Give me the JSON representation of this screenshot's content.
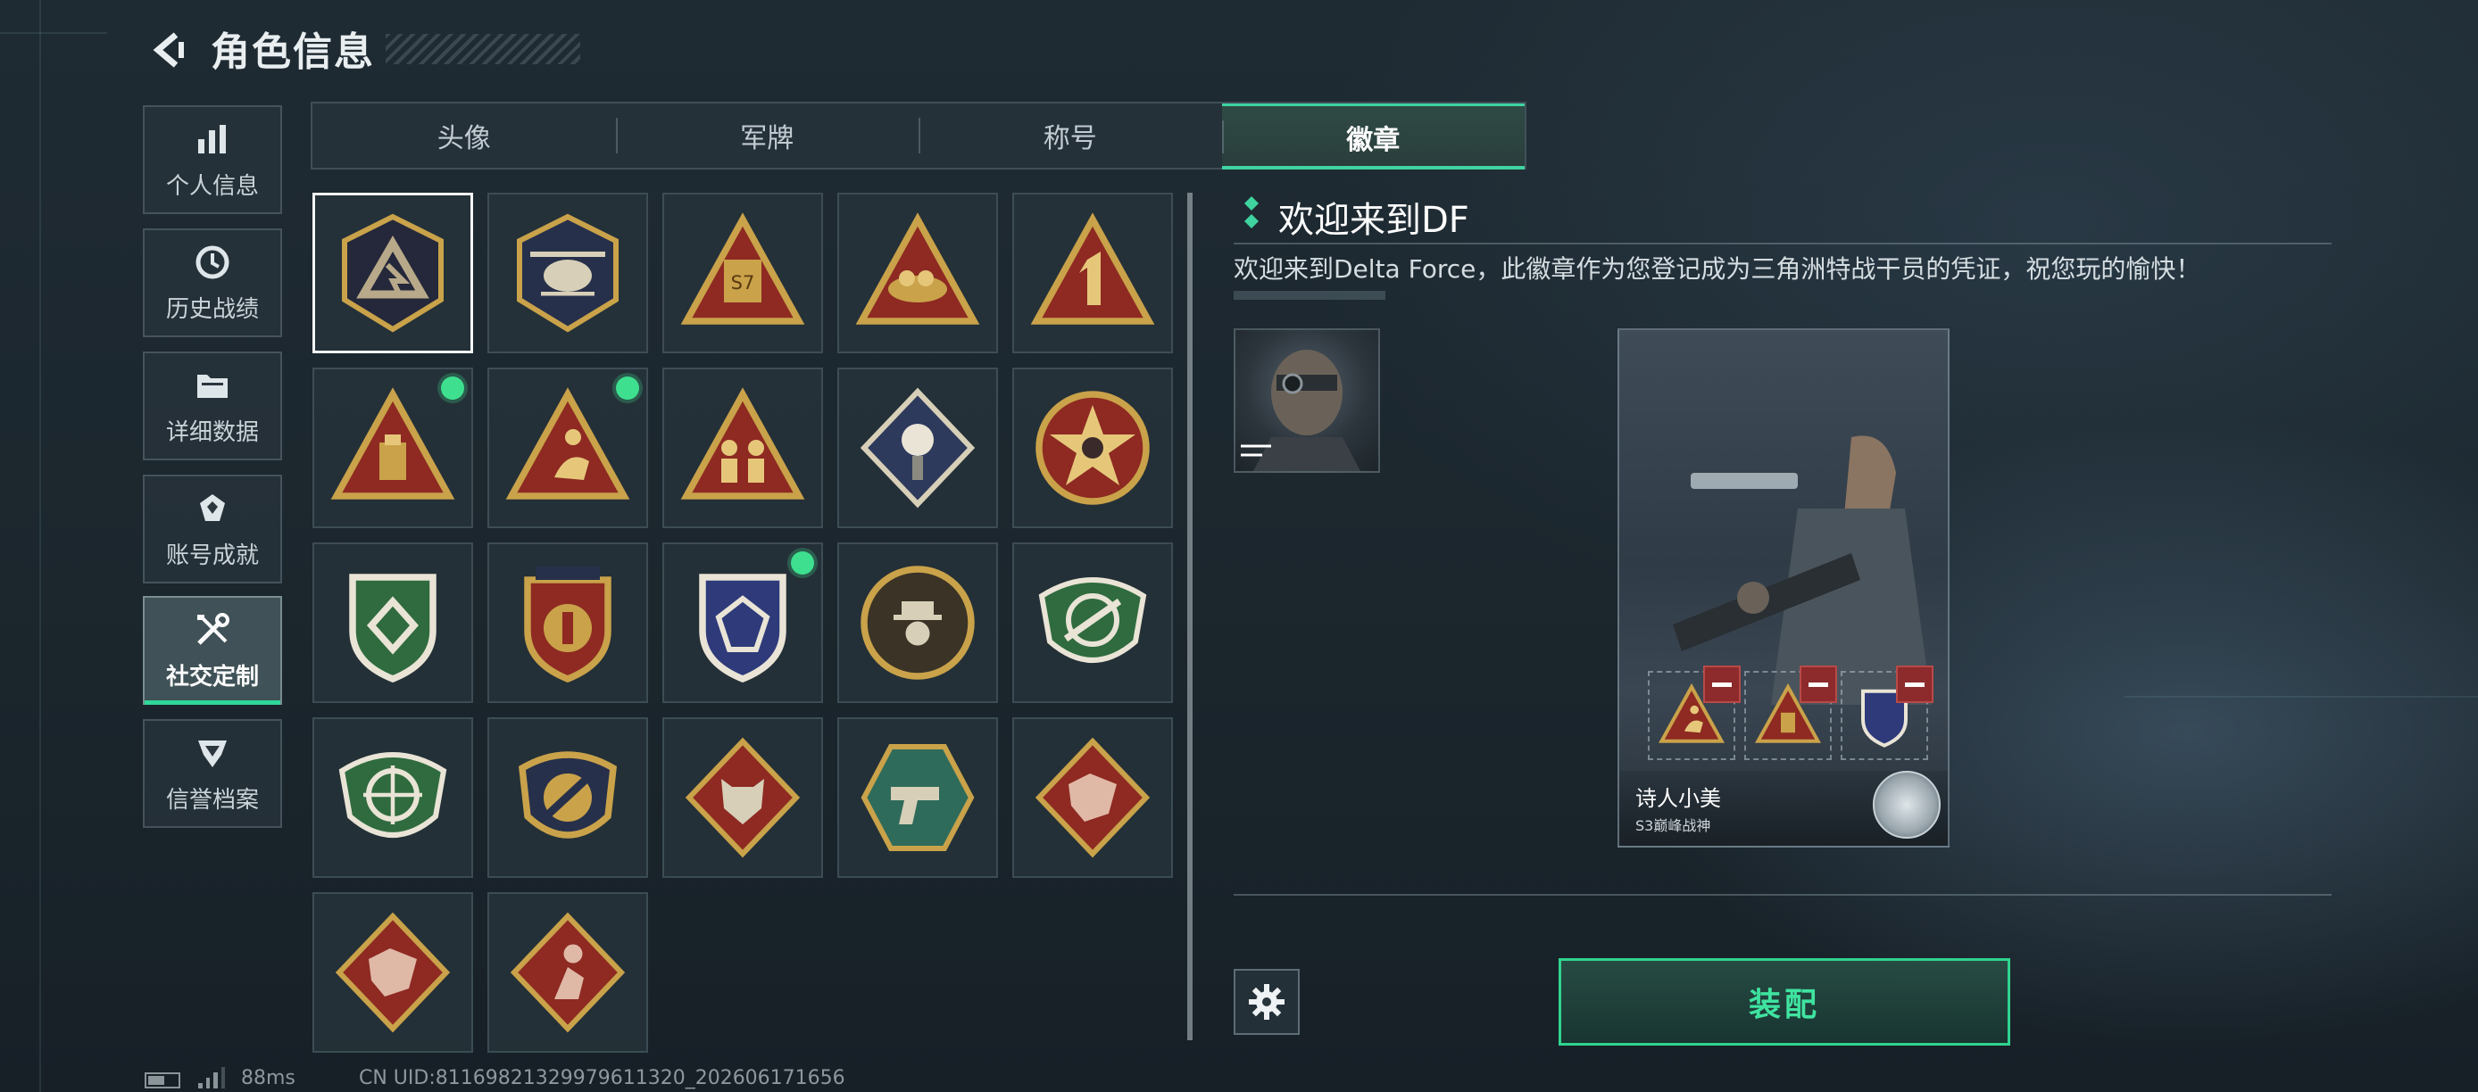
{
  "header": {
    "title": "角色信息"
  },
  "sidebar": {
    "items": [
      {
        "label": "个人信息",
        "icon": "bar-chart-icon"
      },
      {
        "label": "历史战绩",
        "icon": "clock-history-icon"
      },
      {
        "label": "详细数据",
        "icon": "folder-icon"
      },
      {
        "label": "账号成就",
        "icon": "achievement-icon"
      },
      {
        "label": "社交定制",
        "icon": "tools-icon",
        "active": true
      },
      {
        "label": "信誉档案",
        "icon": "shield-rank-icon"
      }
    ]
  },
  "tabs": [
    {
      "label": "头像"
    },
    {
      "label": "军牌"
    },
    {
      "label": "称号"
    },
    {
      "label": "徽章",
      "active": true
    }
  ],
  "badges": [
    {
      "name": "delta-triangle-badge",
      "new": false,
      "selected": true
    },
    {
      "name": "helicopter-badge",
      "new": false
    },
    {
      "name": "s7-triangle-badge",
      "new": false
    },
    {
      "name": "nest-triangle-badge",
      "new": false
    },
    {
      "name": "number-one-triangle-badge",
      "new": false
    },
    {
      "name": "usb-triangle-badge",
      "new": true
    },
    {
      "name": "surfer-triangle-badge",
      "new": true
    },
    {
      "name": "soldiers-triangle-badge",
      "new": false
    },
    {
      "name": "rose-diamond-badge",
      "new": false
    },
    {
      "name": "star-skull-round-badge",
      "new": false
    },
    {
      "name": "green-diamond-shield-badge",
      "new": false
    },
    {
      "name": "gold-star-shield-badge",
      "new": false
    },
    {
      "name": "blue-gem-shield-badge",
      "new": true
    },
    {
      "name": "gentleman-round-badge",
      "new": false
    },
    {
      "name": "green-rifle-shield-badge",
      "new": false
    },
    {
      "name": "green-crosshair-shield-badge",
      "new": false
    },
    {
      "name": "gold-rocket-shield-badge",
      "new": false
    },
    {
      "name": "wolf-diamond-badge",
      "new": false
    },
    {
      "name": "pistol-hexagon-badge",
      "new": false
    },
    {
      "name": "dragon-red-diamond-badge",
      "new": false
    },
    {
      "name": "dragon-red-diamond-badge-2",
      "new": false
    },
    {
      "name": "runner-red-diamond-badge",
      "new": false
    }
  ],
  "detail": {
    "title": "欢迎来到DF",
    "description": "欢迎来到Delta Force，此徽章作为您登记成为三角洲特战干员的凭证，祝您玩的愉快！"
  },
  "card": {
    "player_name": "诗人小美",
    "rank": "S3巅峰战神"
  },
  "actions": {
    "equip_label": "装配"
  },
  "status": {
    "ping": "88ms",
    "uid": "CN UID:8116982132997961132​0_202606171656"
  },
  "colors": {
    "accent": "#3fd3a0",
    "new_dot": "#3ee08f",
    "remove": "#8c2a2c",
    "badge_gold": "#c9a24a",
    "badge_red": "#8e2a22",
    "badge_green": "#2f6b3e",
    "badge_navy": "#27304a"
  }
}
